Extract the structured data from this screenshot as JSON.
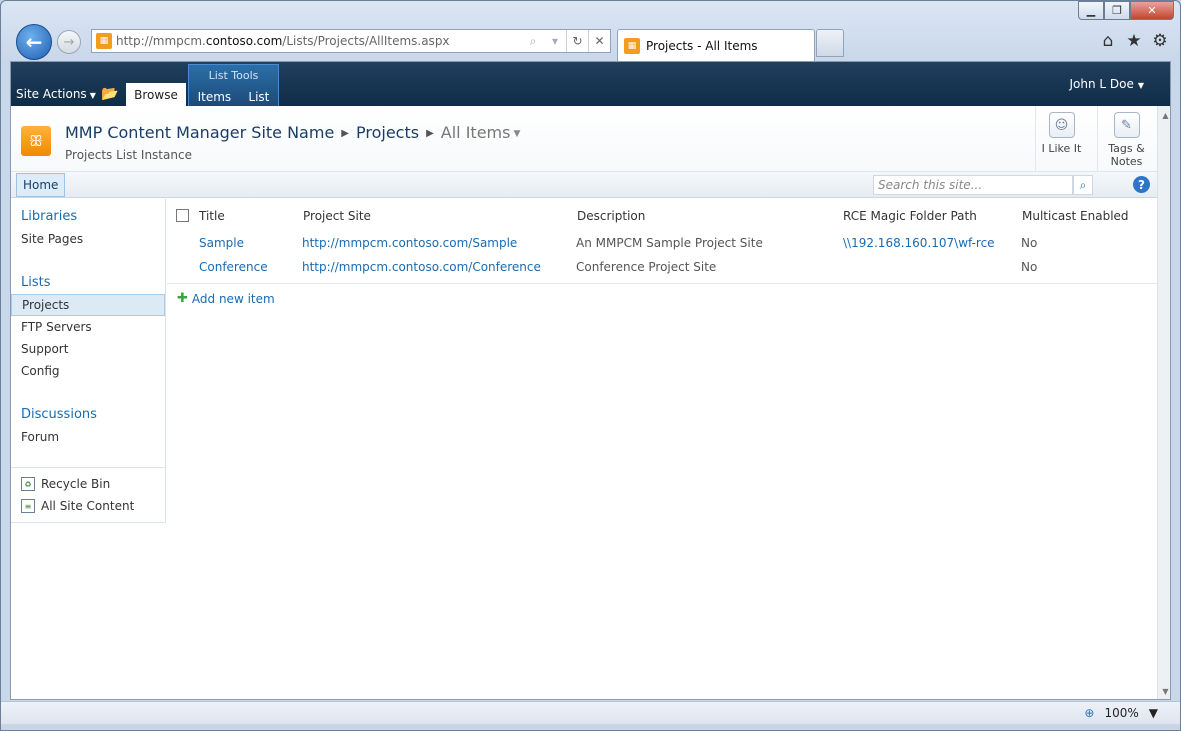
{
  "browser": {
    "url_prefix": "http://mmpcm.",
    "url_host": "contoso.com",
    "url_path": "/Lists/Projects/AllItems.aspx",
    "tab_title": "Projects - All Items",
    "zoom": "100%"
  },
  "ribbon": {
    "site_actions": "Site Actions",
    "tab_browse": "Browse",
    "contextual_group": "List Tools",
    "tab_items": "Items",
    "tab_list": "List",
    "user": "John L Doe"
  },
  "title_area": {
    "site_name": "MMP Content Manager Site Name",
    "list_name": "Projects",
    "view_name": "All Items",
    "description": "Projects List Instance",
    "like_label": "I Like It",
    "tags_label_1": "Tags &",
    "tags_label_2": "Notes"
  },
  "topnav": {
    "home": "Home",
    "search_placeholder": "Search this site..."
  },
  "leftnav": {
    "libraries_head": "Libraries",
    "libraries": [
      "Site Pages"
    ],
    "lists_head": "Lists",
    "lists": [
      "Projects",
      "FTP Servers",
      "Support",
      "Config"
    ],
    "selected": "Projects",
    "discussions_head": "Discussions",
    "discussions": [
      "Forum"
    ],
    "recycle_bin": "Recycle Bin",
    "all_site_content": "All Site Content"
  },
  "list": {
    "columns": [
      "Title",
      "Project Site",
      "Description",
      "RCE Magic Folder Path",
      "Multicast Enabled"
    ],
    "rows": [
      {
        "title": "Sample",
        "site": "http://mmpcm.contoso.com/Sample",
        "description": "An MMPCM Sample Project Site",
        "path": "\\\\192.168.160.107\\wf-rce",
        "multicast": "No"
      },
      {
        "title": "Conference",
        "site": "http://mmpcm.contoso.com/Conference",
        "description": "Conference Project Site",
        "path": "",
        "multicast": "No"
      }
    ],
    "add_new": "Add new item"
  }
}
